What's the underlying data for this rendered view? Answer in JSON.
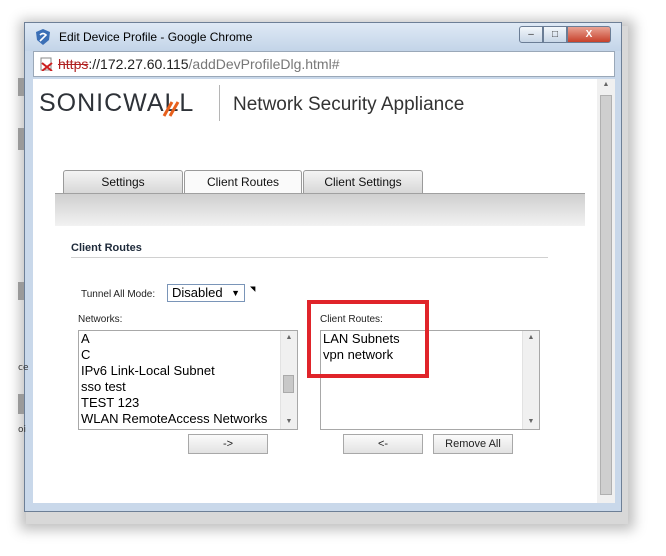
{
  "window": {
    "title": "Edit Device Profile - Google Chrome",
    "controls": {
      "minimize": "–",
      "maximize": "□",
      "close": "X"
    }
  },
  "address_bar": {
    "scheme": "https",
    "host": "://172.27.60.115",
    "path": "/addDevProfileDlg.html#"
  },
  "header": {
    "brand": "SONICWALL",
    "product": "Network Security Appliance"
  },
  "tabs": [
    {
      "label": "Settings",
      "active": false
    },
    {
      "label": "Client Routes",
      "active": true
    },
    {
      "label": "Client Settings",
      "active": false
    }
  ],
  "section": {
    "title": "Client Routes"
  },
  "tunnel_all_mode": {
    "label": "Tunnel All Mode:",
    "value": "Disabled"
  },
  "networks": {
    "label": "Networks:",
    "items": [
      "A",
      "C",
      "IPv6 Link-Local Subnet",
      "sso test",
      "TEST 123",
      "WLAN RemoteAccess Networks"
    ]
  },
  "client_routes": {
    "label": "Client Routes:",
    "items": [
      "LAN Subnets",
      "vpn network"
    ]
  },
  "buttons": {
    "add": "->",
    "remove": "<-",
    "remove_all": "Remove All"
  },
  "colors": {
    "highlight": "#e0242a",
    "brand_accent": "#e8601c"
  }
}
